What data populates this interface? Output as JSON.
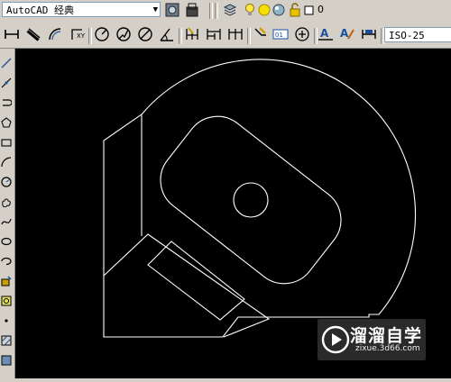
{
  "toolbar": {
    "workspace_value": "AutoCAD 经典",
    "layer_name": "0",
    "dimstyle_value": "ISO-25"
  },
  "watermark": {
    "title": "溜溜自学",
    "url": "zixue.3d66.com"
  },
  "colors": {
    "canvas": "#000000",
    "ui": "#d4d0c8",
    "drawing": "#ffffff"
  },
  "icons": {
    "top": [
      "workspace-settings-icon",
      "workspace-lock-icon",
      "layer-properties-icon",
      "lightbulb-icon",
      "sun-icon",
      "freeze-icon",
      "lock-icon",
      "color-square-icon"
    ],
    "dimension": [
      "linear-dim-icon",
      "aligned-dim-icon",
      "arc-length-icon",
      "ordinate-dim-icon",
      "radius-dim-icon",
      "jogged-dim-icon",
      "diameter-dim-icon",
      "angular-dim-icon",
      "quick-dim-icon",
      "baseline-dim-icon",
      "continue-dim-icon",
      "quick-leader-icon",
      "tolerance-icon",
      "center-mark-icon",
      "dim-edit-icon",
      "dim-text-edit-icon",
      "dim-update-icon"
    ],
    "draw": [
      "line-icon",
      "construction-line-icon",
      "polyline-icon",
      "polygon-icon",
      "rectangle-icon",
      "arc-icon",
      "circle-icon",
      "revcloud-icon",
      "spline-icon",
      "ellipse-icon",
      "ellipse-arc-icon",
      "insert-block-icon",
      "make-block-icon",
      "point-icon",
      "hatch-icon",
      "gradient-icon"
    ]
  }
}
